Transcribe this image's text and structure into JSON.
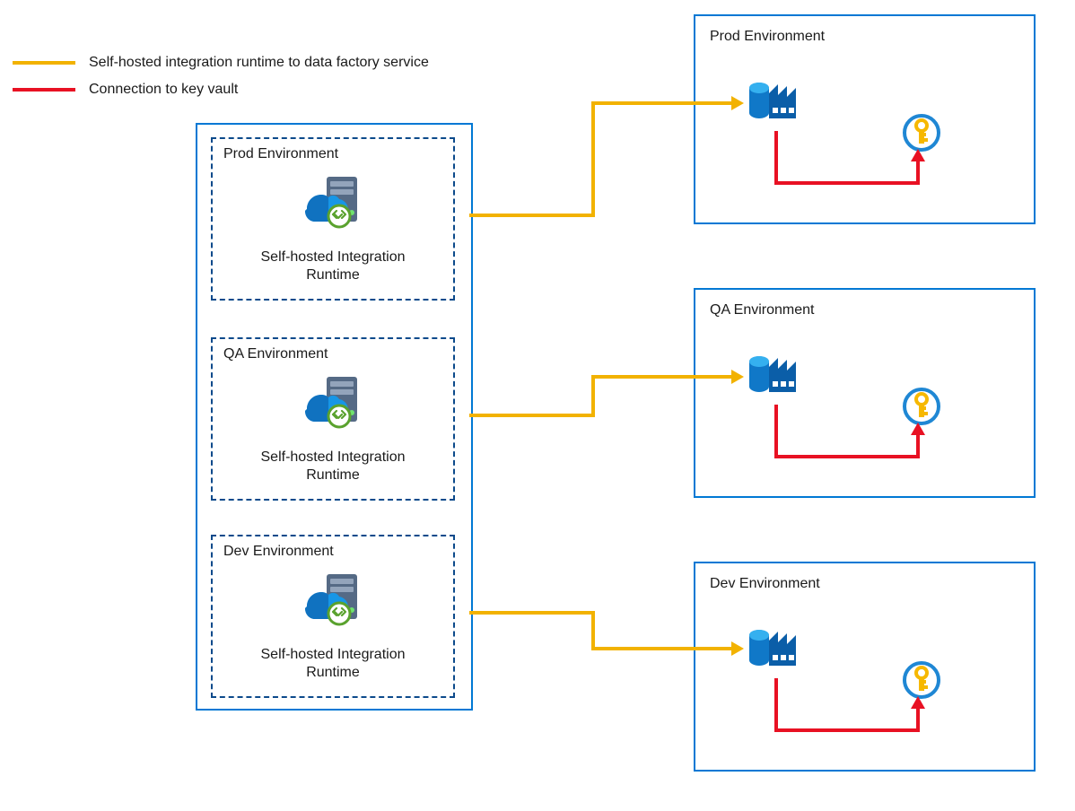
{
  "legend": {
    "items": [
      {
        "label": "Self-hosted integration runtime to data factory service",
        "color": "#f2b200"
      },
      {
        "label": "Connection to key vault",
        "color": "#e81123"
      }
    ]
  },
  "shir": {
    "caption": "Self-hosted Integration Runtime",
    "boxes": [
      {
        "title": "Prod Environment"
      },
      {
        "title": "QA Environment"
      },
      {
        "title": "Dev Environment"
      }
    ]
  },
  "env": {
    "boxes": [
      {
        "title": "Prod Environment"
      },
      {
        "title": "QA Environment"
      },
      {
        "title": "Dev Environment"
      }
    ]
  },
  "icons": {
    "shir": "self-hosted-integration-runtime-icon",
    "data_factory": "azure-data-factory-icon",
    "key_vault": "azure-key-vault-icon"
  }
}
